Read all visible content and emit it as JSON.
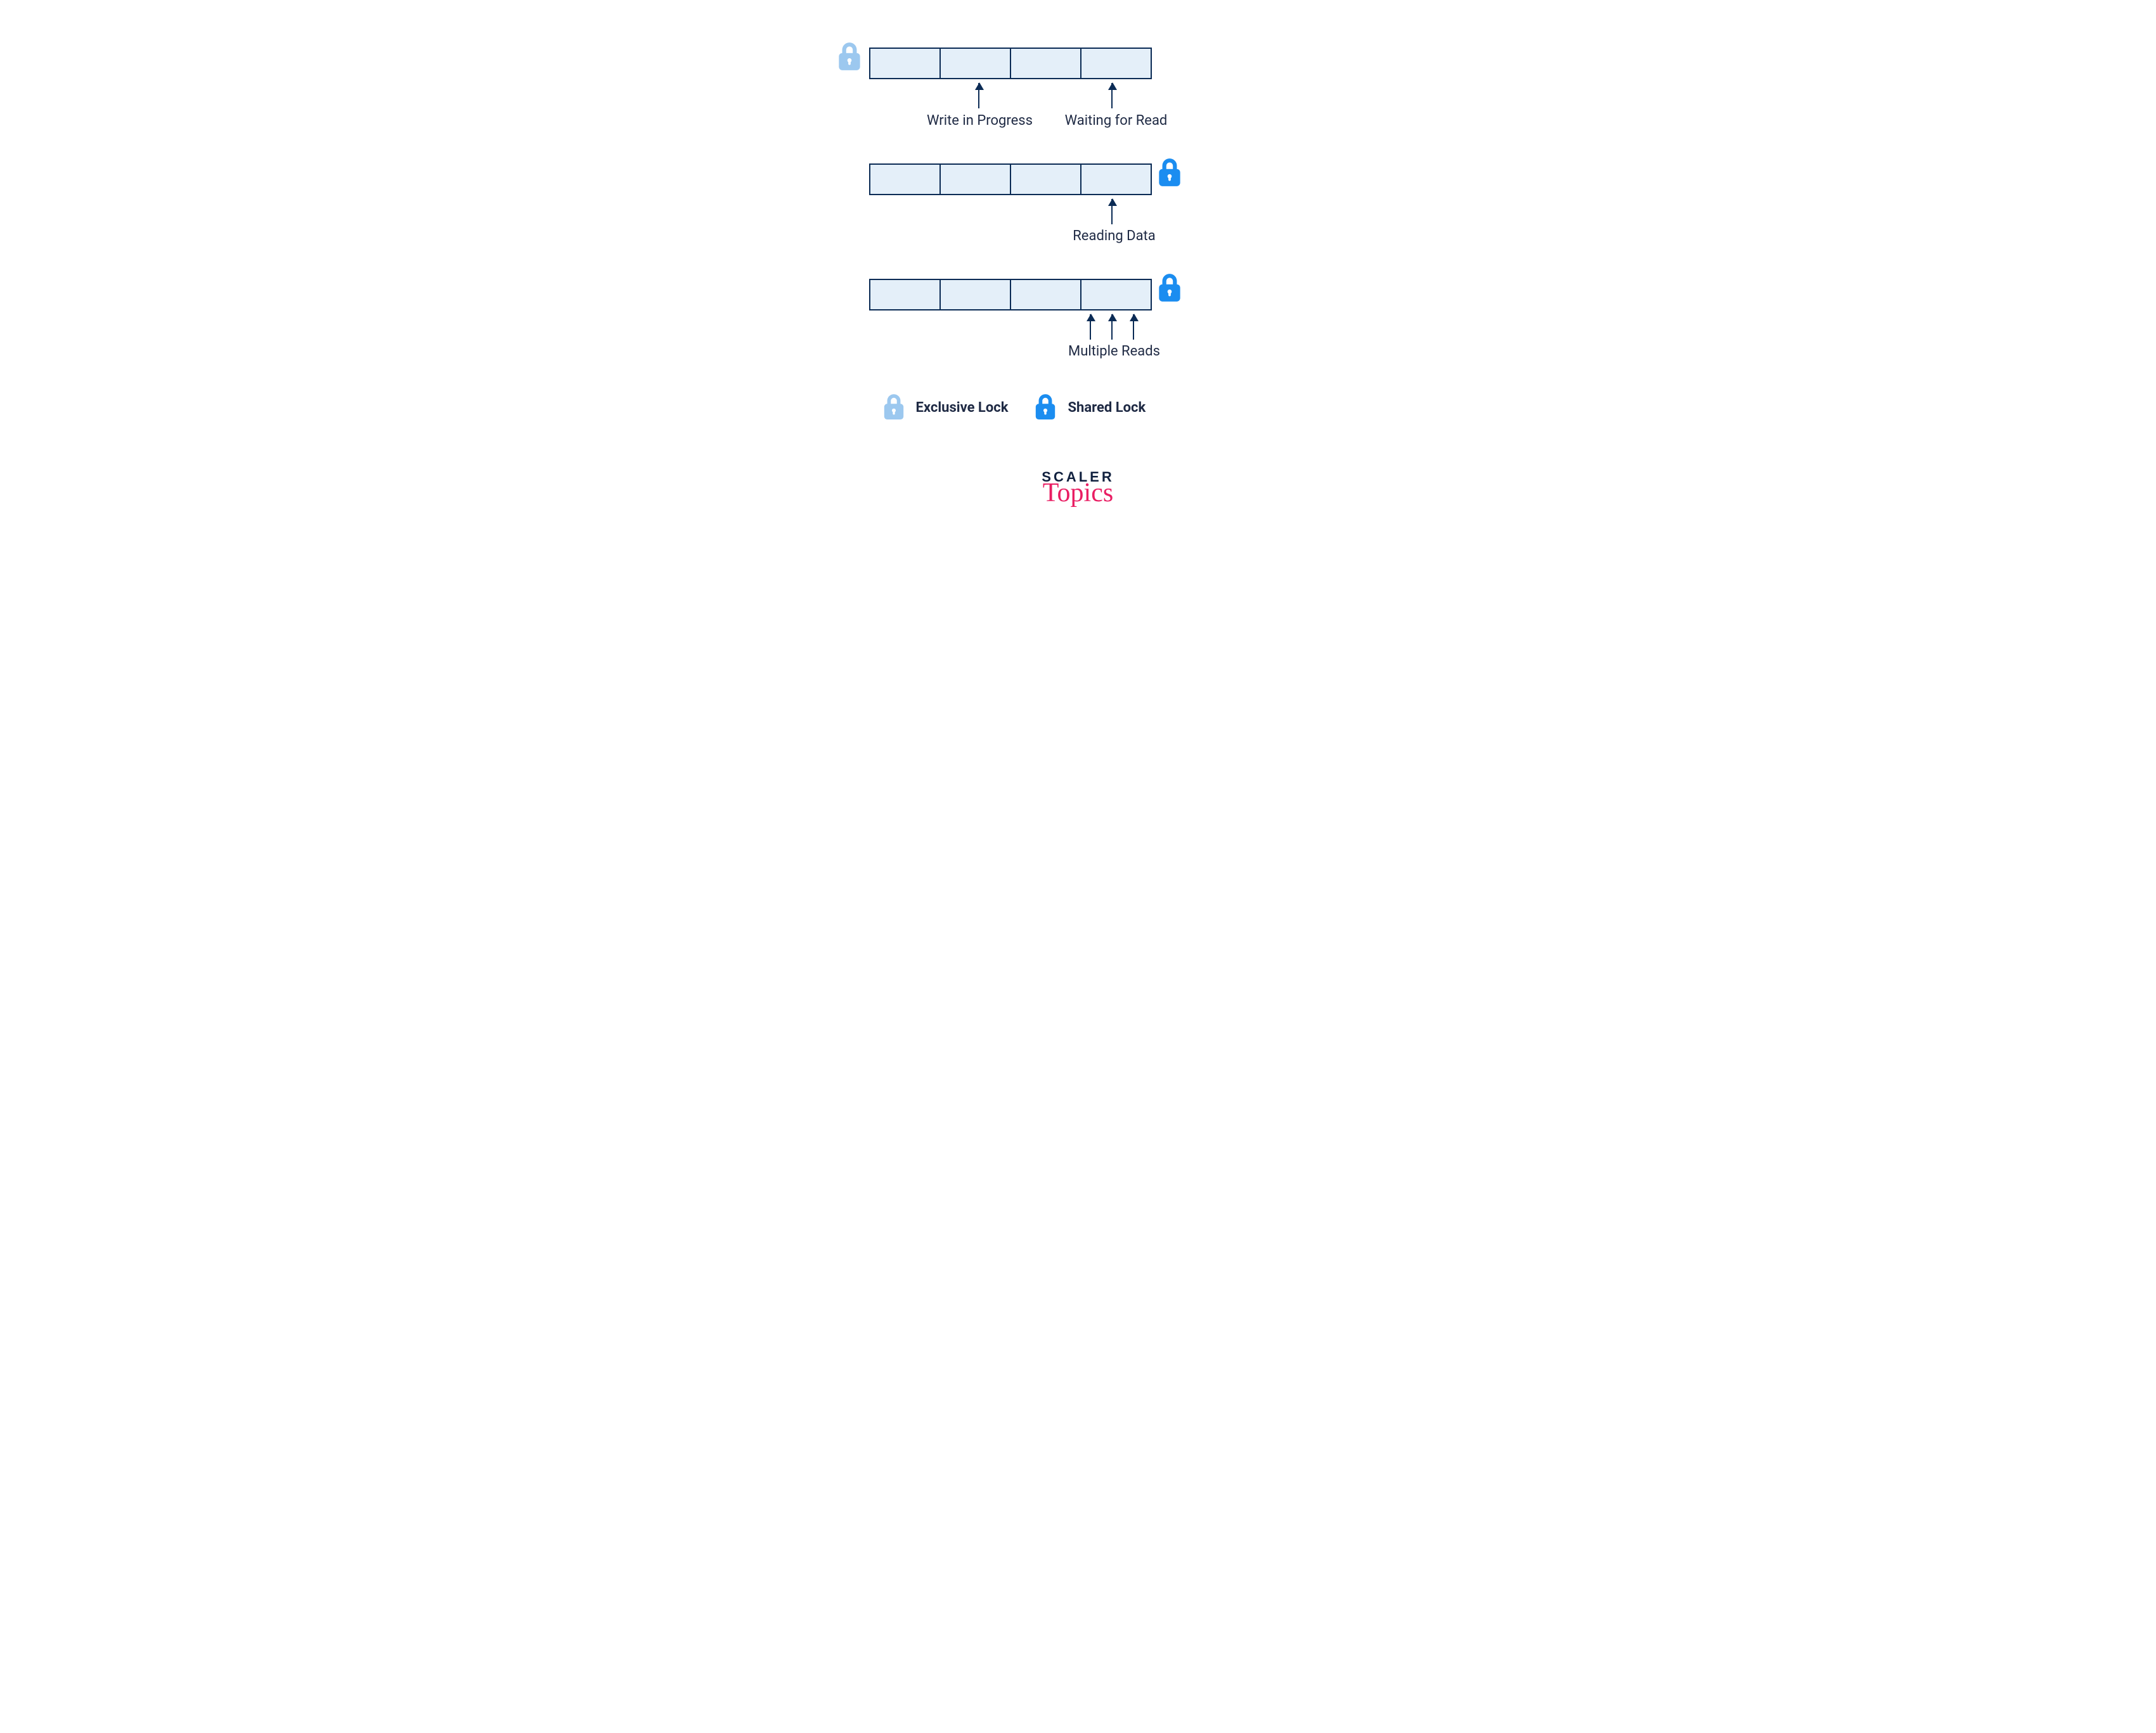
{
  "colors": {
    "cell_fill": "#e4eff9",
    "cell_border": "#0b2b55",
    "lock_exclusive": "#9cc8ef",
    "lock_shared": "#1b8df0",
    "text": "#1f2a44",
    "brand_dark": "#11213f",
    "brand_pink": "#e91e63"
  },
  "rows": {
    "row1": {
      "lock_side": "left",
      "lock_type": "exclusive",
      "arrows": [
        {
          "label": "Write in Progress"
        },
        {
          "label": "Waiting for Read"
        }
      ]
    },
    "row2": {
      "lock_side": "right",
      "lock_type": "shared",
      "arrows": [
        {
          "label": "Reading Data"
        }
      ]
    },
    "row3": {
      "lock_side": "right",
      "lock_type": "shared",
      "arrows_label": "Multiple Reads"
    }
  },
  "legend": {
    "exclusive": "Exclusive Lock",
    "shared": "Shared Lock"
  },
  "brand": {
    "top": "SCALER",
    "bottom": "Topics"
  }
}
